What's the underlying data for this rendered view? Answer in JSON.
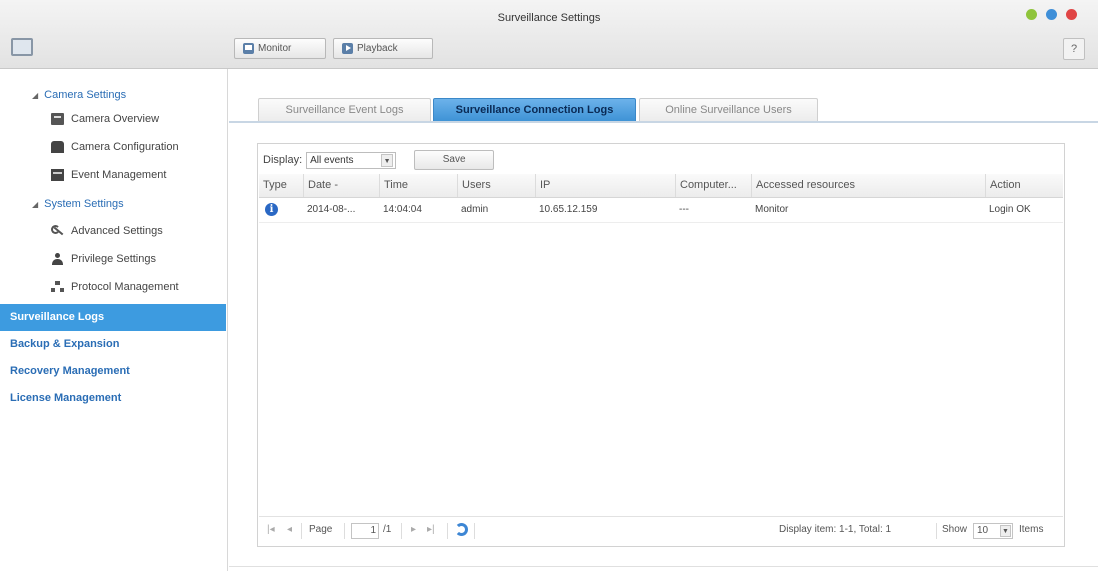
{
  "window": {
    "title": "Surveillance Settings",
    "controls": [
      "minimize",
      "maximize",
      "close"
    ]
  },
  "toolbar": {
    "monitor_label": "Monitor",
    "playback_label": "Playback",
    "help_label": "?"
  },
  "sidebar": {
    "camera_settings": {
      "label": "Camera Settings",
      "items": [
        {
          "label": "Camera Overview",
          "icon": "camera-overview-icon"
        },
        {
          "label": "Camera Configuration",
          "icon": "camera-configuration-icon"
        },
        {
          "label": "Event Management",
          "icon": "event-management-icon"
        }
      ]
    },
    "system_settings": {
      "label": "System Settings",
      "items": [
        {
          "label": "Advanced Settings",
          "icon": "wrench-icon"
        },
        {
          "label": "Privilege Settings",
          "icon": "user-icon"
        },
        {
          "label": "Protocol Management",
          "icon": "network-icon"
        }
      ]
    },
    "top_items": [
      {
        "label": "Surveillance Logs",
        "active": true
      },
      {
        "label": "Backup & Expansion"
      },
      {
        "label": "Recovery Management"
      },
      {
        "label": "License Management"
      }
    ]
  },
  "tabs": [
    {
      "label": "Surveillance Event Logs"
    },
    {
      "label": "Surveillance Connection Logs",
      "active": true
    },
    {
      "label": "Online Surveillance Users"
    }
  ],
  "filter": {
    "display_label": "Display:",
    "selected": "All events",
    "save_label": "Save"
  },
  "grid": {
    "columns": [
      "Type",
      "Date",
      "Time",
      "Users",
      "IP",
      "Computer...",
      "Accessed resources",
      "Action"
    ],
    "date_sort_indicator": "-",
    "rows": [
      {
        "type": "i",
        "date": "2014-08-...",
        "time": "14:04:04",
        "user": "admin",
        "ip": "10.65.12.159",
        "computer": "---",
        "resource": "Monitor",
        "action": "Login OK"
      }
    ]
  },
  "pager": {
    "first": "|◂",
    "prev": "◂",
    "page_label": "Page",
    "page_value": "1",
    "of_total": "/1",
    "next": "▸",
    "last": "▸|",
    "display_info": "Display item: 1-1, Total: 1",
    "show_label": "Show",
    "show_value": "10",
    "items_label": "Items"
  },
  "colors": {
    "accent": "#3d9be0",
    "link": "#2a6db5",
    "info": "#2a68c4"
  }
}
